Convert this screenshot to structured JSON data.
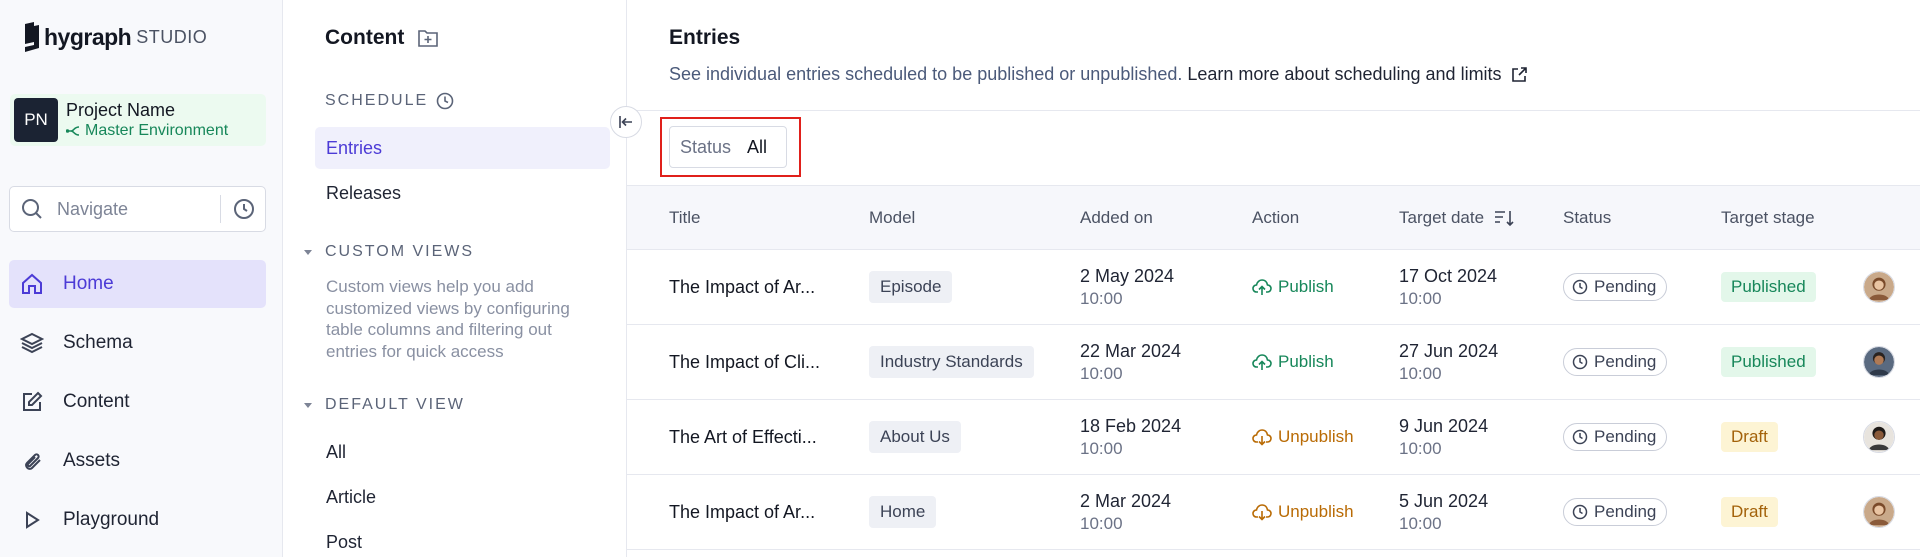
{
  "brand": {
    "name": "hygraph",
    "suffix": "STUDIO"
  },
  "project": {
    "initials": "PN",
    "name": "Project Name",
    "environment": "Master Environment"
  },
  "nav": {
    "search_placeholder": "Navigate",
    "items": [
      {
        "label": "Home",
        "icon": "home-icon",
        "active": true
      },
      {
        "label": "Schema",
        "icon": "layers-icon"
      },
      {
        "label": "Content",
        "icon": "edit-icon"
      },
      {
        "label": "Assets",
        "icon": "paperclip-icon"
      },
      {
        "label": "Playground",
        "icon": "play-icon"
      }
    ]
  },
  "subnav": {
    "title": "Content",
    "schedule_heading": "SCHEDULE",
    "schedule_items": [
      {
        "label": "Entries",
        "active": true
      },
      {
        "label": "Releases"
      }
    ],
    "custom_views_heading": "CUSTOM VIEWS",
    "custom_views_desc": "Custom views help you add customized views by configuring table columns and filtering out entries for quick access",
    "default_view_heading": "DEFAULT VIEW",
    "default_view_items": [
      {
        "label": "All"
      },
      {
        "label": "Article"
      },
      {
        "label": "Post"
      }
    ]
  },
  "main": {
    "title": "Entries",
    "description": "See individual entries scheduled to be published or unpublished.",
    "learn_more": "Learn more about scheduling and limits",
    "filter": {
      "label": "Status",
      "value": "All"
    },
    "columns": [
      "Title",
      "Model",
      "Added on",
      "Action",
      "Target date",
      "Status",
      "Target stage"
    ],
    "rows": [
      {
        "title": "The Impact of Ar...",
        "model": "Episode",
        "added_date": "2 May 2024",
        "added_time": "10:00",
        "action": "Publish",
        "target_date": "17 Oct 2024",
        "target_time": "10:00",
        "status": "Pending",
        "stage": "Published"
      },
      {
        "title": "The Impact of Cli...",
        "model": "Industry Standards",
        "added_date": "22 Mar 2024",
        "added_time": "10:00",
        "action": "Publish",
        "target_date": "27 Jun 2024",
        "target_time": "10:00",
        "status": "Pending",
        "stage": "Published"
      },
      {
        "title": "The Art of Effecti...",
        "model": "About Us",
        "added_date": "18 Feb 2024",
        "added_time": "10:00",
        "action": "Unpublish",
        "target_date": "9 Jun 2024",
        "target_time": "10:00",
        "status": "Pending",
        "stage": "Draft"
      },
      {
        "title": "The Impact of Ar...",
        "model": "Home",
        "added_date": "2 Mar 2024",
        "added_time": "10:00",
        "action": "Unpublish",
        "target_date": "5 Jun 2024",
        "target_time": "10:00",
        "status": "Pending",
        "stage": "Draft"
      }
    ]
  },
  "colors": {
    "accent": "#4c3bd6",
    "publish": "#17875a",
    "unpublish": "#b96b05",
    "highlight": "#e0201b"
  }
}
